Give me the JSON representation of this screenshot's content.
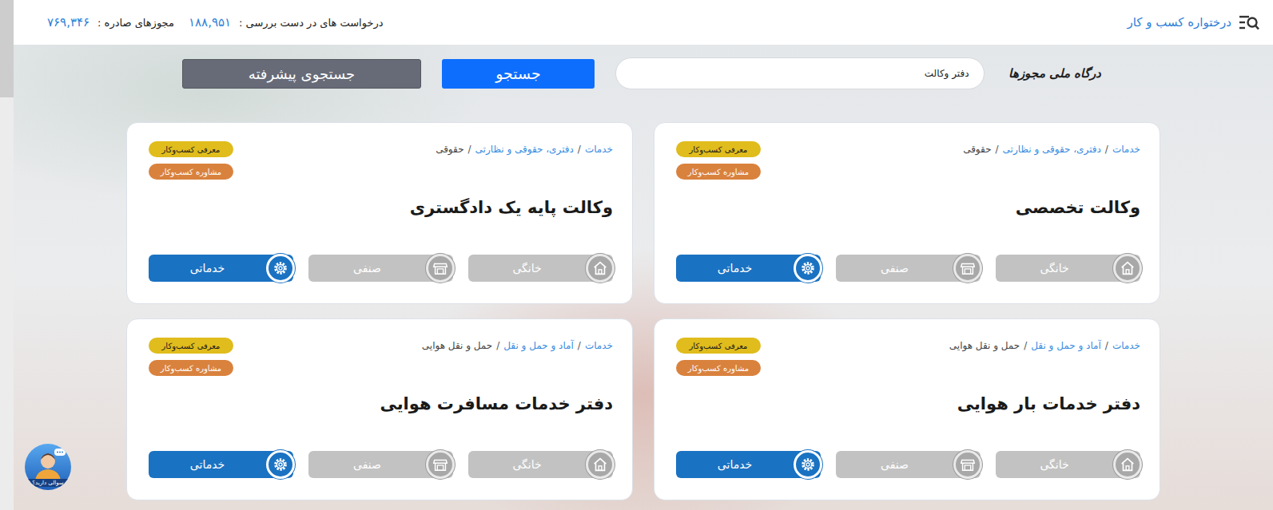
{
  "topbar": {
    "nav_label": "درختواره کسب و کار",
    "stats": [
      {
        "label": "درخواست های در دست بررسی :",
        "value": "۱۸۸,۹۵۱"
      },
      {
        "label": "مجوزهای صادره :",
        "value": "۷۶۹,۳۴۶"
      }
    ]
  },
  "search": {
    "logo": "درگاه ملی مجوزها",
    "value": "دفتر وکالت",
    "search_button": "جستجو",
    "advanced_button": "جستجوی پیشرفته"
  },
  "breadcrumb_separator": "/",
  "cards": [
    {
      "breadcrumb": [
        {
          "label": "خدمات",
          "link": true
        },
        {
          "label": "دفتری، حقوقی و نظارتی",
          "link": true
        },
        {
          "label": "حقوقی",
          "link": false
        }
      ],
      "badges": [
        {
          "label": "معرفی کسب‌وکار",
          "color": "#e0bc1c"
        },
        {
          "label": "مشاوره کسب‌وکار",
          "color": "#d9823e"
        }
      ],
      "title": "وکالت تخصصی",
      "types": [
        {
          "label": "خانگی",
          "selected": false
        },
        {
          "label": "صنفی",
          "selected": false
        },
        {
          "label": "خدماتی",
          "selected": true
        }
      ]
    },
    {
      "breadcrumb": [
        {
          "label": "خدمات",
          "link": true
        },
        {
          "label": "دفتری، حقوقی و نظارتی",
          "link": true
        },
        {
          "label": "حقوقی",
          "link": false
        }
      ],
      "badges": [
        {
          "label": "معرفی کسب‌وکار",
          "color": "#e0bc1c"
        },
        {
          "label": "مشاوره کسب‌وکار",
          "color": "#d9823e"
        }
      ],
      "title": "وکالت پایه یک دادگستری",
      "types": [
        {
          "label": "خانگی",
          "selected": false
        },
        {
          "label": "صنفی",
          "selected": false
        },
        {
          "label": "خدماتی",
          "selected": true
        }
      ]
    },
    {
      "breadcrumb": [
        {
          "label": "خدمات",
          "link": true
        },
        {
          "label": "آماد و حمل و نقل",
          "link": true
        },
        {
          "label": "حمل و نقل هوایی",
          "link": false
        }
      ],
      "badges": [
        {
          "label": "معرفی کسب‌وکار",
          "color": "#e0bc1c"
        },
        {
          "label": "مشاوره کسب‌وکار",
          "color": "#d9823e"
        }
      ],
      "title": "دفتر خدمات بار هوایی",
      "types": [
        {
          "label": "خانگی",
          "selected": false
        },
        {
          "label": "صنفی",
          "selected": false
        },
        {
          "label": "خدماتی",
          "selected": true
        }
      ]
    },
    {
      "breadcrumb": [
        {
          "label": "خدمات",
          "link": true
        },
        {
          "label": "آماد و حمل و نقل",
          "link": true
        },
        {
          "label": "حمل و نقل هوایی",
          "link": false
        }
      ],
      "badges": [
        {
          "label": "معرفی کسب‌وکار",
          "color": "#e0bc1c"
        },
        {
          "label": "مشاوره کسب‌وکار",
          "color": "#d9823e"
        }
      ],
      "title": "دفتر خدمات مسافرت هوایی",
      "types": [
        {
          "label": "خانگی",
          "selected": false
        },
        {
          "label": "صنفی",
          "selected": false
        },
        {
          "label": "خدماتی",
          "selected": true
        }
      ]
    }
  ],
  "help": {
    "label": "سوالی دارید؟"
  }
}
